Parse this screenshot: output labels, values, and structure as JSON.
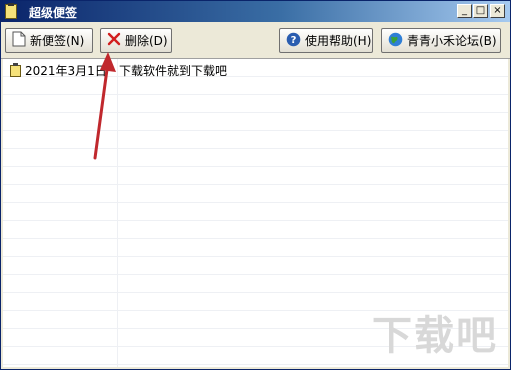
{
  "window": {
    "title": "超级便签",
    "controls": {
      "minimize": "_",
      "maximize": "□",
      "close": "×"
    }
  },
  "toolbar": {
    "new_label": "新便签(N)",
    "delete_label": "删除(D)",
    "help_label": "使用帮助(H)",
    "forum_label": "青青小禾论坛(B)"
  },
  "notes": [
    {
      "date": "2021年3月1日",
      "text": "下载软件就到下载吧"
    }
  ],
  "watermark": {
    "text": "下载吧",
    "url": "www.xiazaiba.com"
  },
  "colors": {
    "annotation_arrow": "#c0282d",
    "titlebar": "#0a246a",
    "delete_icon": "#d21e1e",
    "help_icon": "#2a5db0"
  }
}
